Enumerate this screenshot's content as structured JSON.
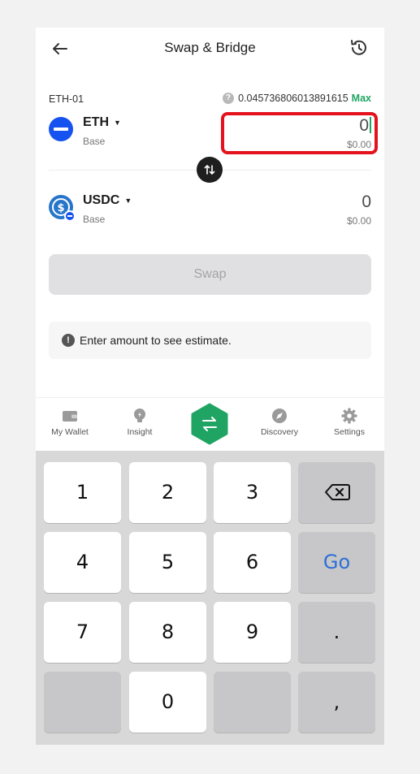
{
  "header": {
    "title": "Swap & Bridge"
  },
  "from": {
    "account": "ETH-01",
    "balance": "0.045736806013891615",
    "max_label": "Max",
    "token": "ETH",
    "chain": "Base",
    "amount": "0",
    "fiat": "$0.00"
  },
  "to": {
    "token": "USDC",
    "chain": "Base",
    "amount": "0",
    "fiat": "$0.00"
  },
  "swap_button": "Swap",
  "notice": "Enter amount to see estimate.",
  "tabs": [
    {
      "label": "My Wallet"
    },
    {
      "label": "Insight"
    },
    {
      "label": ""
    },
    {
      "label": "Discovery"
    },
    {
      "label": "Settings"
    }
  ],
  "keyboard": {
    "keys": [
      "1",
      "2",
      "3",
      "4",
      "5",
      "6",
      "7",
      "8",
      "9",
      "0"
    ],
    "go_label": "Go",
    "period": ".",
    "comma": ","
  },
  "colors": {
    "accent": "#1fa463",
    "highlight": "#e3121c",
    "eth_blue": "#1652f0",
    "usdc_blue": "#2775ca"
  }
}
